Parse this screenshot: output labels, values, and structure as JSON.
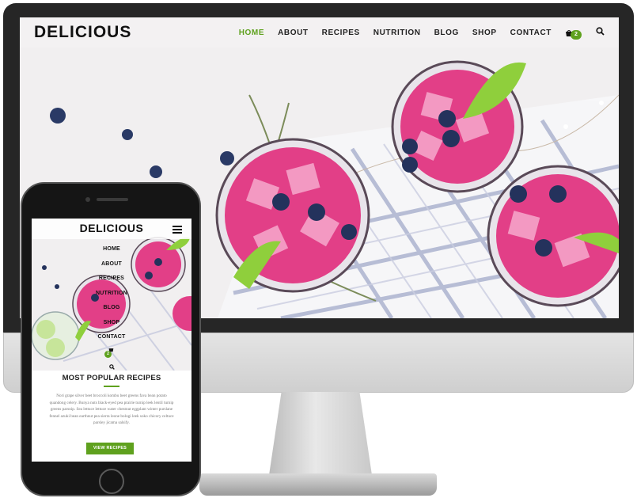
{
  "desktop": {
    "logo": "DELICIOUS",
    "nav": [
      "HOME",
      "ABOUT",
      "RECIPES",
      "NUTRITION",
      "BLOG",
      "SHOP",
      "CONTACT"
    ],
    "active_nav": "HOME",
    "cart_count": "2",
    "accent_color": "#5fa11e"
  },
  "mobile": {
    "logo": "DELICIOUS",
    "menu": [
      "HOME",
      "ABOUT",
      "RECIPES",
      "NUTRITION",
      "BLOG",
      "SHOP",
      "CONTACT"
    ],
    "cart_count": "2",
    "section_title": "MOST POPULAR RECIPES",
    "paragraph": "Nori grape silver beet broccoli kombu beet greens fava bean potato quandong celery. Bunya nuts black-eyed pea prairie turnip leek lentil turnip greens parsnip. Sea lettuce lettuce water chestnut eggplant winter purslane fennel azuki bean earthnut pea sierra leone bologi leek soko chicory celtuce parsley jícama salsify.",
    "button_label": "VIEW RECIPES"
  }
}
